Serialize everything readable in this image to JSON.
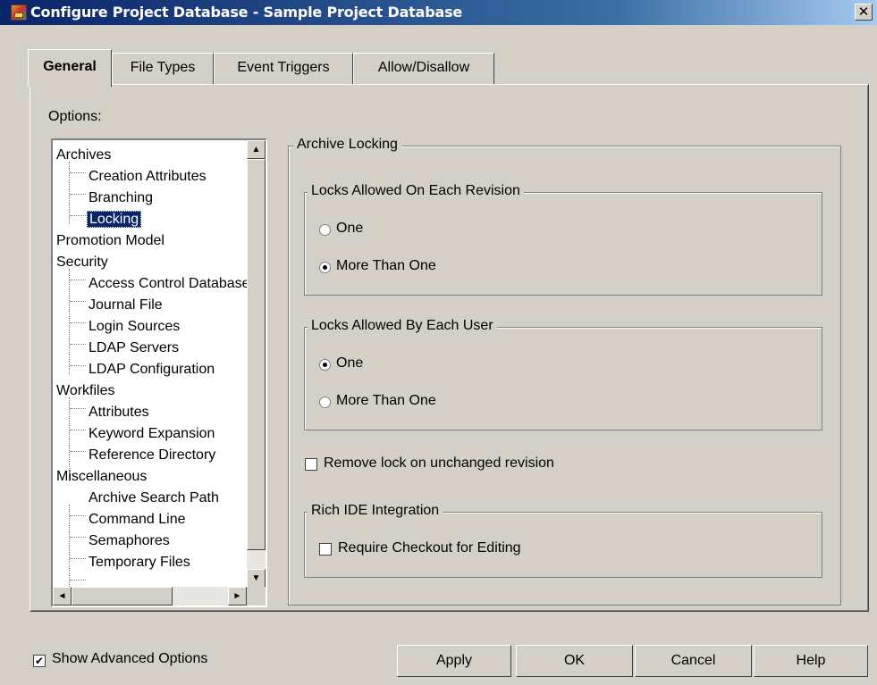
{
  "window": {
    "title": "Configure Project Database - Sample Project Database",
    "close_glyph": "✕"
  },
  "tabs": [
    {
      "label": "General",
      "active": true
    },
    {
      "label": "File Types",
      "active": false
    },
    {
      "label": "Event Triggers",
      "active": false
    },
    {
      "label": "Allow/Disallow",
      "active": false
    }
  ],
  "options_label": "Options:",
  "tree": {
    "items": [
      {
        "label": "Archives",
        "level": 0
      },
      {
        "label": "Creation Attributes",
        "level": 1
      },
      {
        "label": "Branching",
        "level": 1
      },
      {
        "label": "Locking",
        "level": 1,
        "selected": true
      },
      {
        "label": "Promotion Model",
        "level": 0
      },
      {
        "label": "Security",
        "level": 0
      },
      {
        "label": "Access Control Database",
        "level": 1
      },
      {
        "label": "Journal File",
        "level": 1
      },
      {
        "label": "Login Sources",
        "level": 1
      },
      {
        "label": "LDAP Servers",
        "level": 1
      },
      {
        "label": "LDAP Configuration",
        "level": 1
      },
      {
        "label": "Workfiles",
        "level": 0
      },
      {
        "label": "Attributes",
        "level": 1
      },
      {
        "label": "Keyword Expansion",
        "level": 1
      },
      {
        "label": "Reference Directory",
        "level": 1
      },
      {
        "label": "Miscellaneous",
        "level": 0
      },
      {
        "label": "Archive Search Path",
        "level": 1
      },
      {
        "label": "Command Line",
        "level": 1
      },
      {
        "label": "Semaphores",
        "level": 1
      },
      {
        "label": "Temporary Files",
        "level": 1
      }
    ],
    "scroll_glyphs": {
      "up": "▲",
      "down": "▼",
      "left": "◄",
      "right": "►"
    }
  },
  "archive_locking": {
    "title": "Archive Locking",
    "per_revision": {
      "title": "Locks Allowed On Each Revision",
      "options": [
        {
          "label": "One",
          "checked": false
        },
        {
          "label": "More Than One",
          "checked": true
        }
      ]
    },
    "per_user": {
      "title": "Locks Allowed By Each User",
      "options": [
        {
          "label": "One",
          "checked": true
        },
        {
          "label": "More Than One",
          "checked": false
        }
      ]
    },
    "remove_lock": {
      "label": "Remove lock on unchanged revision",
      "checked": false
    },
    "rich_ide": {
      "title": "Rich IDE Integration",
      "require_checkout": {
        "label": "Require Checkout for Editing",
        "checked": false
      }
    }
  },
  "footer": {
    "show_advanced": {
      "label": "Show Advanced Options",
      "checked": true,
      "mark": "✔"
    },
    "buttons": {
      "apply": "Apply",
      "ok": "OK",
      "cancel": "Cancel",
      "help": "Help"
    }
  }
}
